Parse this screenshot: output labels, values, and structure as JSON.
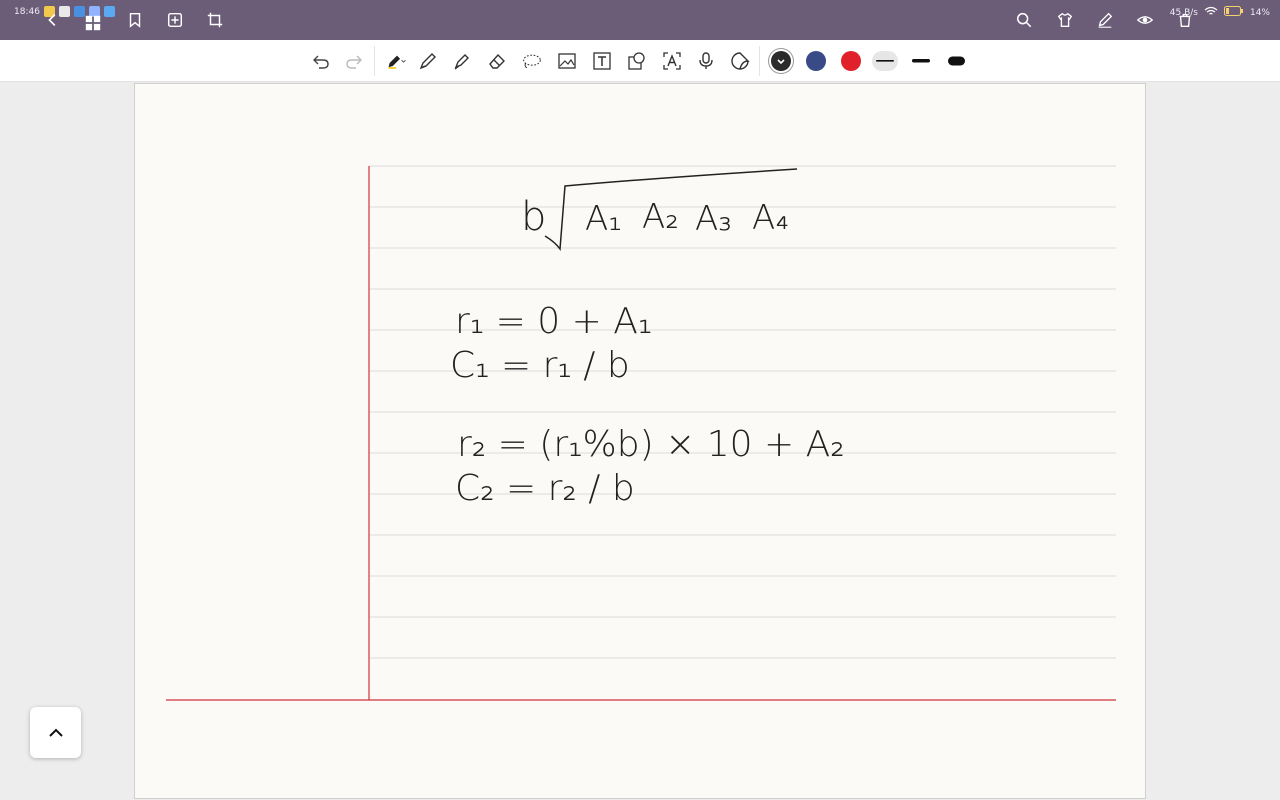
{
  "status_bar": {
    "time": "18:46",
    "net_speed": "45 B/s",
    "battery": "14%"
  },
  "top_icons": [
    "back-icon",
    "bookmark-icon",
    "add-page-icon",
    "crop-icon",
    "search-icon",
    "shirt-icon",
    "pen-edit-icon",
    "reading-mode-icon",
    "delete-icon"
  ],
  "toolbar": {
    "tools": [
      "undo",
      "redo",
      "pen",
      "fountain-pen",
      "highlighter",
      "eraser",
      "lasso",
      "image",
      "text",
      "shape",
      "ocr",
      "voice",
      "sticker"
    ],
    "colors": [
      "#2b2b2b",
      "#3a4a86",
      "#e0202b"
    ],
    "selected_color": "#2b2b2b",
    "stroke_widths": [
      "thin",
      "medium",
      "thick"
    ],
    "selected_stroke": "thin"
  },
  "handwriting": {
    "division": {
      "divisor": "b",
      "dividend": [
        "A₁",
        "A₂",
        "A₃",
        "A₄"
      ]
    },
    "lines": [
      "r₁ = 0 + A₁",
      "C₁ = r₁ / b",
      "r₂ = (r₁%b) × 10 + A₂",
      "C₂ = r₂ / b"
    ]
  },
  "colors": {
    "title_bar": "#6b5d78",
    "paper": "#fcfaf6",
    "margin_line": "#d0333b",
    "rule_line": "#dcdcdc"
  }
}
